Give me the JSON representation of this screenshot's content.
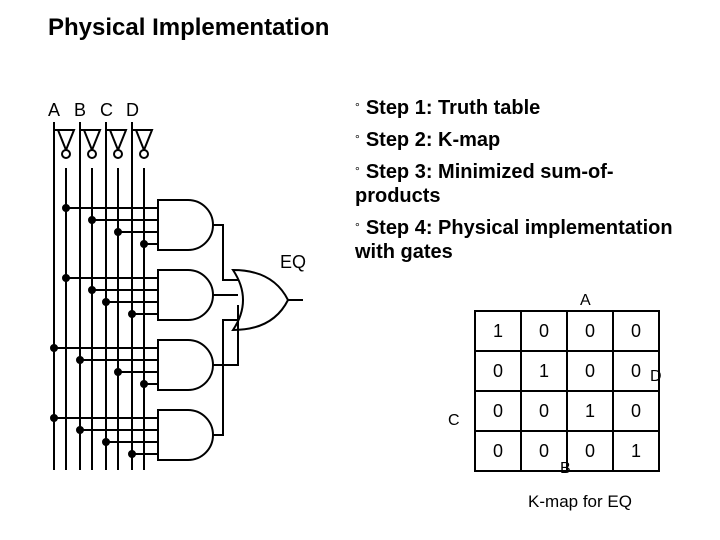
{
  "title": "Physical Implementation",
  "inputs": [
    "A",
    "B",
    "C",
    "D"
  ],
  "output_label": "EQ",
  "steps": [
    "Step 1: Truth table",
    "Step 2: K-map",
    "Step 3: Minimized sum-of-products",
    "Step 4: Physical implementation with gates"
  ],
  "kmap": {
    "col_var_top": "A",
    "col_var_bottom": "B",
    "row_var_left": "C",
    "row_var_right": "D",
    "cells": [
      [
        1,
        0,
        0,
        0
      ],
      [
        0,
        1,
        0,
        0
      ],
      [
        0,
        0,
        1,
        0
      ],
      [
        0,
        0,
        0,
        1
      ]
    ],
    "caption": "K-map for EQ"
  }
}
